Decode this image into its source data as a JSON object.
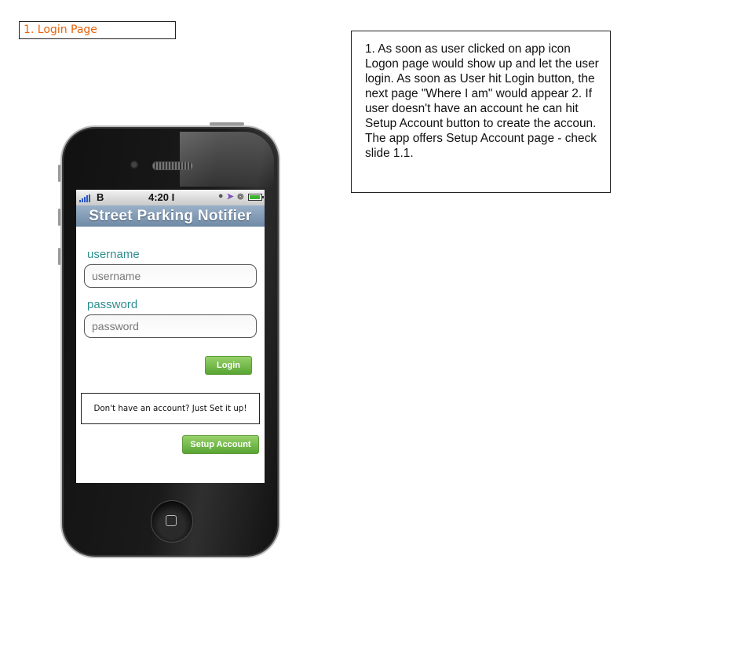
{
  "slide_label": "1. Login Page",
  "note": "1. As soon as user clicked on app icon Logon page would show up and let the user login. As soon as User hit Login button, the next page \"Where I am\" would appear 2. If user doesn't have an account he can hit Setup Account button to create the accoun. The app offers Setup Account page - check slide 1.1.",
  "status_bar": {
    "carrier": "B",
    "time": "4:20 I"
  },
  "app": {
    "title": "Street Parking Notifier",
    "username": {
      "label": "username",
      "placeholder": "username",
      "value": ""
    },
    "password": {
      "label": "password",
      "placeholder": "password",
      "value": ""
    },
    "login_label": "Login",
    "signup_hint": "Don't have an account? Just Set it up!",
    "setup_label": "Setup Account"
  },
  "colors": {
    "slide_label": "#e8630a",
    "field_label": "#2f8f8f",
    "button_green": "#58a532",
    "titlebar": "#7f98b3"
  }
}
